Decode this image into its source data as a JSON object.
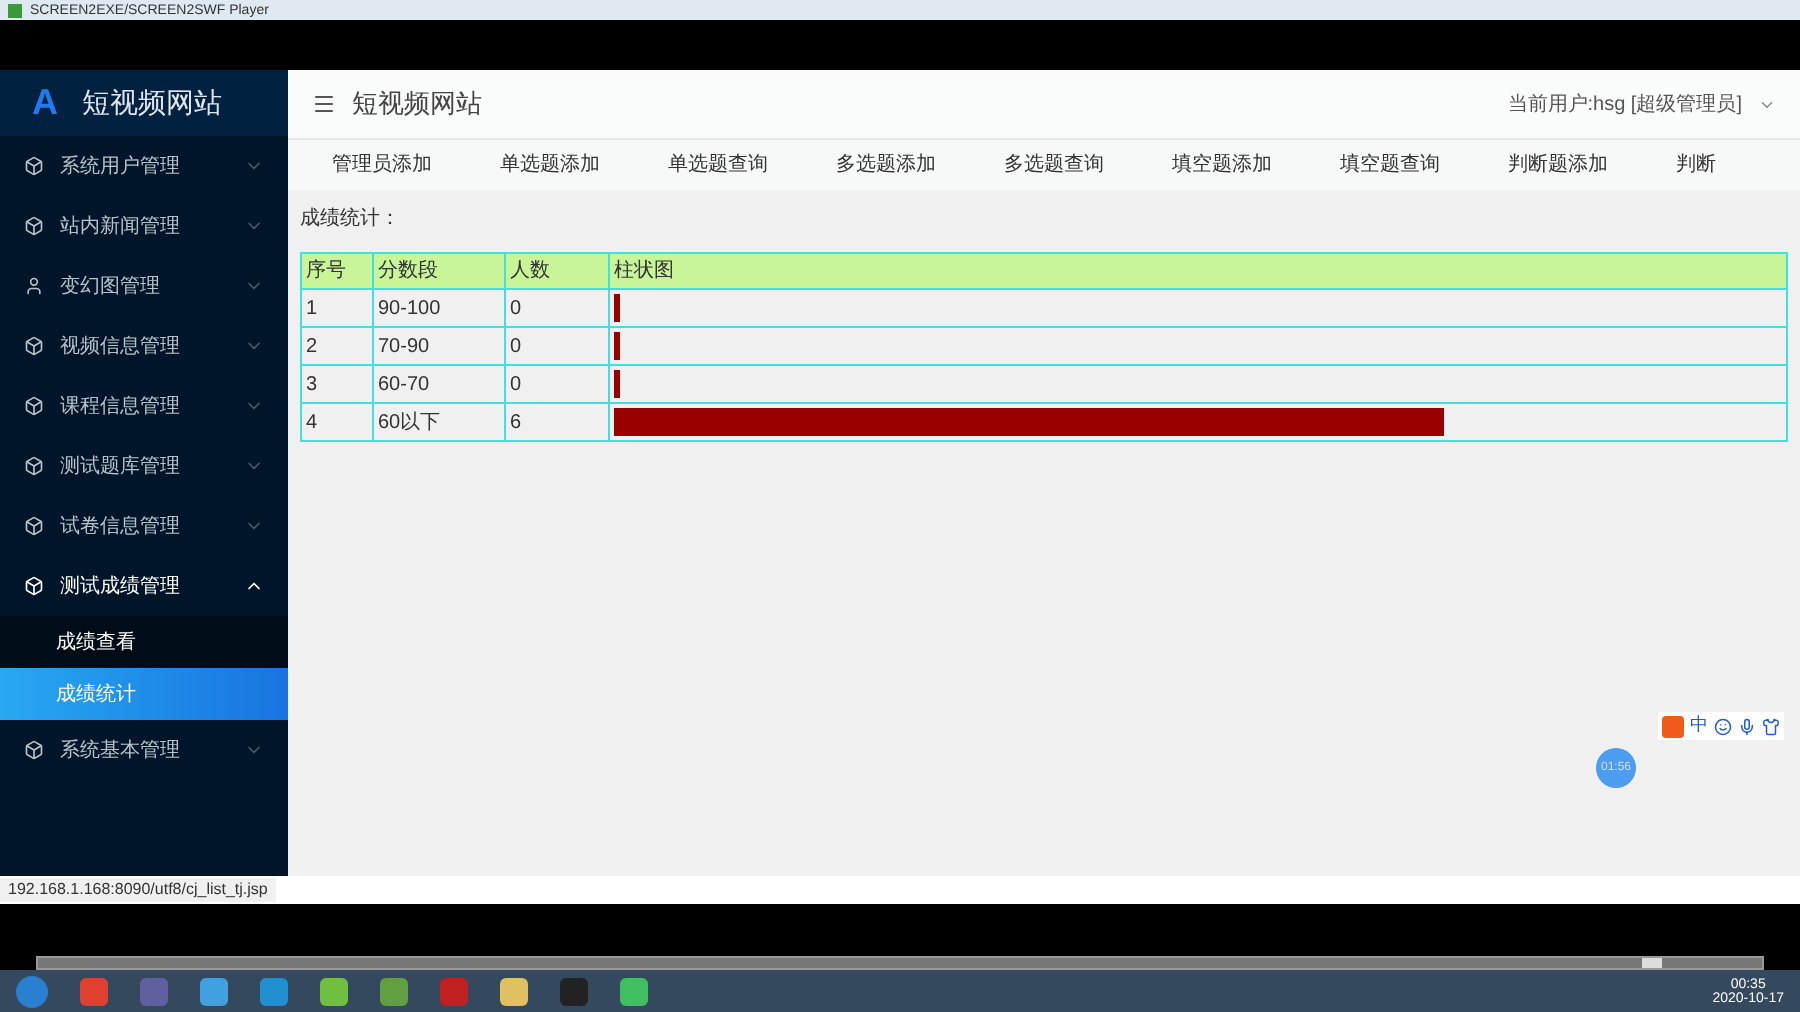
{
  "window": {
    "title": "SCREEN2EXE/SCREEN2SWF Player"
  },
  "sidebar": {
    "logo": "A",
    "title": "短视频网站",
    "items": [
      {
        "label": "系统用户管理",
        "kind": "module",
        "expanded": false
      },
      {
        "label": "站内新闻管理",
        "kind": "module",
        "expanded": false
      },
      {
        "label": "变幻图管理",
        "kind": "user",
        "expanded": false
      },
      {
        "label": "视频信息管理",
        "kind": "module",
        "expanded": false
      },
      {
        "label": "课程信息管理",
        "kind": "module",
        "expanded": false
      },
      {
        "label": "测试题库管理",
        "kind": "module",
        "expanded": false
      },
      {
        "label": "试卷信息管理",
        "kind": "module",
        "expanded": false
      },
      {
        "label": "测试成绩管理",
        "kind": "module",
        "expanded": true,
        "children": [
          {
            "label": "成绩查看",
            "selected": false
          },
          {
            "label": "成绩统计",
            "selected": true
          }
        ]
      },
      {
        "label": "系统基本管理",
        "kind": "module",
        "expanded": false
      }
    ]
  },
  "header": {
    "title": "短视频网站",
    "user": "当前用户:hsg [超级管理员]"
  },
  "tabs": [
    {
      "label": "管理员添加"
    },
    {
      "label": "单选题添加"
    },
    {
      "label": "单选题查询"
    },
    {
      "label": "多选题添加"
    },
    {
      "label": "多选题查询"
    },
    {
      "label": "填空题添加"
    },
    {
      "label": "填空题查询"
    },
    {
      "label": "判断题添加"
    },
    {
      "label": "判断"
    }
  ],
  "content": {
    "heading": "成绩统计：",
    "table": {
      "columns": [
        "序号",
        "分数段",
        "人数",
        "柱状图"
      ],
      "rows": [
        {
          "index": "1",
          "range": "90-100",
          "count": "0",
          "level": 0.005
        },
        {
          "index": "2",
          "range": "70-90",
          "count": "0",
          "level": 0.005
        },
        {
          "index": "3",
          "range": "60-70",
          "count": "0",
          "level": 0.005
        },
        {
          "index": "4",
          "range": "60以下",
          "count": "6",
          "level": 0.71
        }
      ]
    }
  },
  "status_url": "192.168.1.168:8090/utf8/cj_list_tj.jsp",
  "ime": {
    "label": "中"
  },
  "timer": "01:56",
  "player": {
    "level": 0.93
  },
  "clock": {
    "time": "00:35",
    "date": "2020-10-17"
  }
}
